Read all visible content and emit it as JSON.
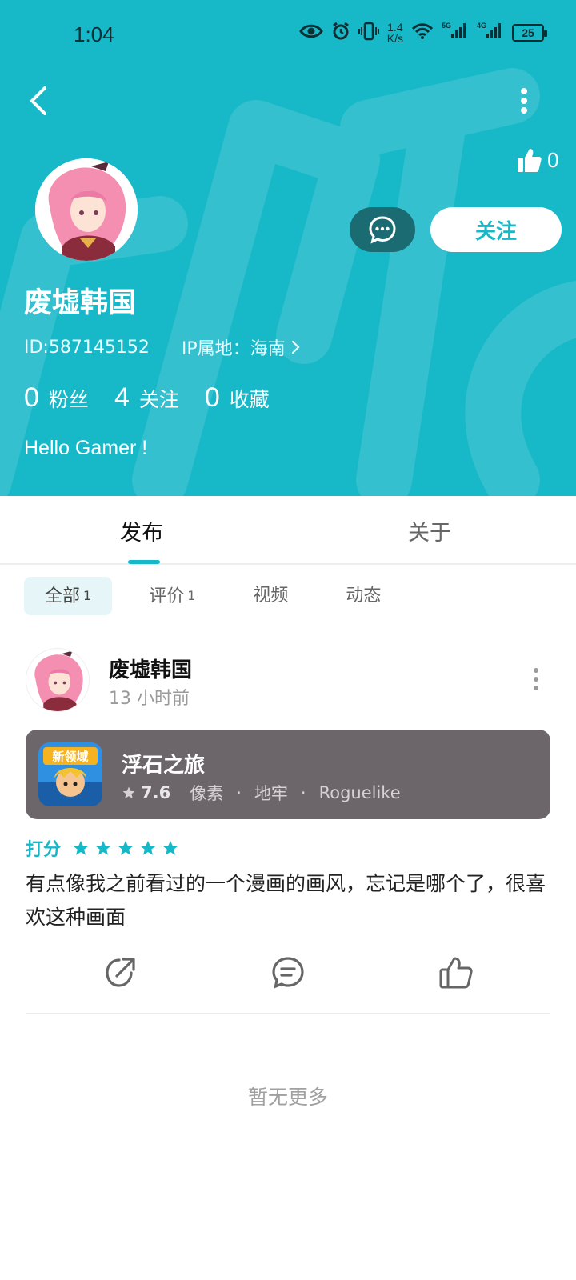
{
  "status_bar": {
    "time": "1:04",
    "net_speed_value": "1.4",
    "net_speed_unit": "K/s",
    "signal_1": "5G",
    "signal_2": "4G",
    "battery": "25"
  },
  "header": {
    "like_count": "0",
    "follow_label": "关注",
    "username": "废墟韩国",
    "user_id": "ID:587145152",
    "ip_location": "IP属地：海南",
    "stats": [
      {
        "count": "0",
        "label": "粉丝"
      },
      {
        "count": "4",
        "label": "关注"
      },
      {
        "count": "0",
        "label": "收藏"
      }
    ],
    "bio": "Hello Gamer !",
    "accent_color": "#17b8c8"
  },
  "tabs": [
    {
      "label": "发布",
      "active": true
    },
    {
      "label": "关于",
      "active": false
    }
  ],
  "filters": [
    {
      "label": "全部",
      "count": "1",
      "active": true
    },
    {
      "label": "评价",
      "count": "1",
      "active": false
    },
    {
      "label": "视频",
      "count": "",
      "active": false
    },
    {
      "label": "动态",
      "count": "",
      "active": false
    }
  ],
  "post": {
    "author": "废墟韩国",
    "time": "13 小时前",
    "game": {
      "name": "浮石之旅",
      "score": "7.6",
      "tags": [
        "像素",
        "地牢",
        "Roguelike"
      ],
      "icon_text": "新领域"
    },
    "rating_label": "打分",
    "stars": 5,
    "text": "有点像我之前看过的一个漫画的画风，忘记是哪个了，很喜欢这种画面"
  },
  "footer": {
    "no_more": "暂无更多"
  }
}
